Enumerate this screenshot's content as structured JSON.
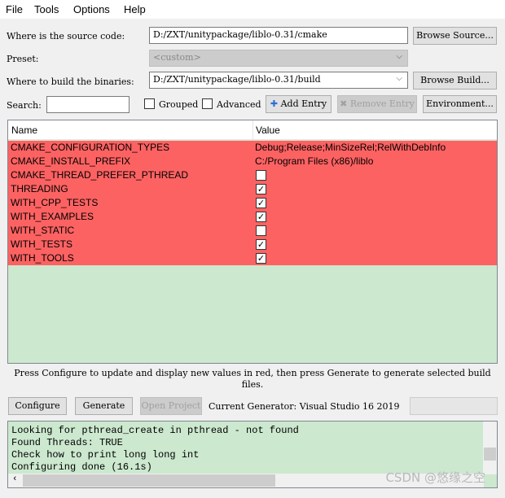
{
  "menu": [
    "File",
    "Tools",
    "Options",
    "Help"
  ],
  "source": {
    "label": "Where is the source code:",
    "value": "D:/ZXT/unitypackage/liblo-0.31/cmake",
    "browse": "Browse Source..."
  },
  "preset": {
    "label": "Preset:",
    "value": "<custom>"
  },
  "build": {
    "label": "Where to build the binaries:",
    "value": "D:/ZXT/unitypackage/liblo-0.31/build",
    "browse": "Browse Build..."
  },
  "search": {
    "label": "Search:",
    "value": ""
  },
  "grouped": {
    "label": "Grouped",
    "checked": false
  },
  "advanced": {
    "label": "Advanced",
    "checked": false
  },
  "add_entry": "Add Entry",
  "remove_entry": "Remove Entry",
  "environment": "Environment...",
  "table": {
    "headers": [
      "Name",
      "Value"
    ],
    "row_color": "#fd6262",
    "bg_color": "#cce8cf",
    "rows": [
      {
        "name": "CMAKE_CONFIGURATION_TYPES",
        "value": "Debug;Release;MinSizeRel;RelWithDebInfo"
      },
      {
        "name": "CMAKE_INSTALL_PREFIX",
        "value": "C:/Program Files (x86)/liblo"
      },
      {
        "name": "CMAKE_THREAD_PREFER_PTHREAD",
        "checked": false
      },
      {
        "name": "THREADING",
        "checked": true
      },
      {
        "name": "WITH_CPP_TESTS",
        "checked": true
      },
      {
        "name": "WITH_EXAMPLES",
        "checked": true
      },
      {
        "name": "WITH_STATIC",
        "checked": false
      },
      {
        "name": "WITH_TESTS",
        "checked": true
      },
      {
        "name": "WITH_TOOLS",
        "checked": true
      }
    ]
  },
  "hint": "Press Configure to update and display new values in red, then press Generate to generate selected build files.",
  "configure": "Configure",
  "generate": "Generate",
  "open_project": "Open Project",
  "generator": "Current Generator: Visual Studio 16 2019",
  "log": [
    "Looking for pthread_create in pthread - not found",
    "Found Threads: TRUE",
    "Check how to print long long int",
    "Configuring done (16.1s)"
  ],
  "watermark": "CSDN @悠缘之空"
}
